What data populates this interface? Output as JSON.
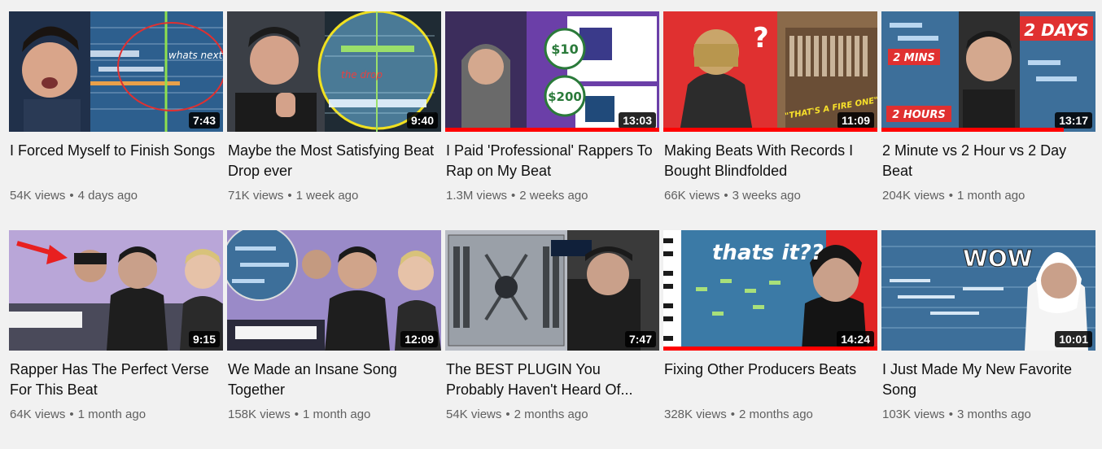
{
  "videos": [
    {
      "title": "I Forced Myself to Finish Songs",
      "views": "54K views",
      "age": "4 days ago",
      "duration": "7:43",
      "watched_fraction": 0.0,
      "thumb_text": "whats next?"
    },
    {
      "title": "Maybe the Most Satisfying Beat Drop ever",
      "views": "71K views",
      "age": "1 week ago",
      "duration": "9:40",
      "watched_fraction": 0.0,
      "thumb_text": "the drop"
    },
    {
      "title": "I Paid 'Professional' Rappers To Rap on My Beat",
      "views": "1.3M views",
      "age": "2 weeks ago",
      "duration": "13:03",
      "watched_fraction": 1.0,
      "thumb_text": "$10",
      "thumb_text2": "$200"
    },
    {
      "title": "Making Beats With Records I Bought Blindfolded",
      "views": "66K views",
      "age": "3 weeks ago",
      "duration": "11:09",
      "watched_fraction": 1.0,
      "thumb_text": "\"THAT'S A FIRE ONE\"",
      "thumb_text2": "?"
    },
    {
      "title": "2 Minute vs 2 Hour vs 2 Day Beat",
      "views": "204K views",
      "age": "1 month ago",
      "duration": "13:17",
      "watched_fraction": 0.85,
      "thumb_text": "2 MINS",
      "thumb_text2": "2 HOURS",
      "thumb_text3": "2 DAYS"
    },
    {
      "title": "Rapper Has The Perfect Verse For This Beat",
      "views": "64K views",
      "age": "1 month ago",
      "duration": "9:15",
      "watched_fraction": 0.0
    },
    {
      "title": "We Made an Insane Song Together",
      "views": "158K views",
      "age": "1 month ago",
      "duration": "12:09",
      "watched_fraction": 0.0
    },
    {
      "title": "The BEST PLUGIN You Probably Haven't Heard Of...",
      "views": "54K views",
      "age": "2 months ago",
      "duration": "7:47",
      "watched_fraction": 0.0
    },
    {
      "title": "Fixing Other Producers Beats",
      "views": "328K views",
      "age": "2 months ago",
      "duration": "14:24",
      "watched_fraction": 1.0,
      "thumb_text": "thats it??"
    },
    {
      "title": "I Just Made My New Favorite Song",
      "views": "103K views",
      "age": "3 months ago",
      "duration": "10:01",
      "watched_fraction": 0.0,
      "thumb_text": "WOW"
    }
  ],
  "separator": "•",
  "colors": {
    "background": "#f1f1f1",
    "progress": "#ff0000",
    "meta_text": "#606060"
  }
}
